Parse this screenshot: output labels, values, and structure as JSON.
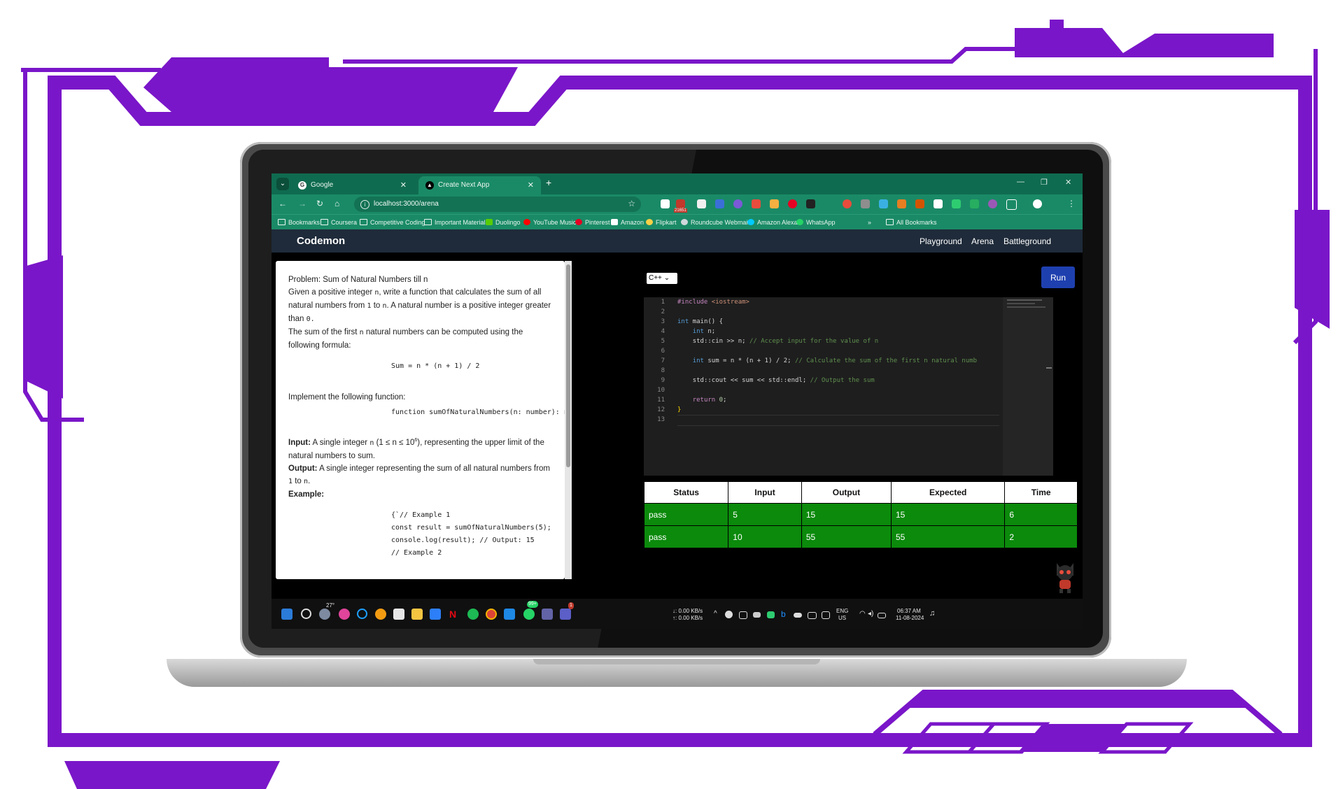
{
  "colors": {
    "purple": "#7a16c9",
    "browser_green": "#1a8a66",
    "tab_green": "#0f6b4f",
    "nav_navy": "#1f2b3a",
    "pass_green": "#0b8a0b",
    "run_blue": "#1e40af"
  },
  "browser": {
    "tabs": [
      {
        "title": "Google",
        "icon": "google-icon"
      },
      {
        "title": "Create Next App",
        "icon": "next-icon"
      }
    ],
    "url": "localhost:3000/arena",
    "bookmarks": [
      "Bookmarks",
      "Coursera",
      "Competitive Coding",
      "Important Materials",
      "Duolingo",
      "YouTube Music",
      "Pinterest",
      "Amazon",
      "Flipkart",
      "Roundcube Webmai...",
      "Amazon Alexa",
      "WhatsApp"
    ],
    "all_bookmarks": "All Bookmarks",
    "more": "»",
    "ext_badge": "21651"
  },
  "app": {
    "brand": "Codemon",
    "nav": [
      "Playground",
      "Arena",
      "Battleground"
    ]
  },
  "problem": {
    "title": "Problem: Sum of Natural Numbers till n",
    "desc1_a": "Given a positive integer ",
    "desc1_b": ", write a function that calculates the sum of all natural numbers from ",
    "desc1_c": " to ",
    "desc1_d": ". A natural number is a positive integer greater than ",
    "desc2_a": "The sum of the first ",
    "desc2_b": " natural numbers can be computed using the following formula:",
    "var_n": "n",
    "one": "1",
    "zero": "0.",
    "formula": "Sum = n * (n + 1) / 2",
    "impl": "Implement the following function:",
    "signature": "function sumOfNaturalNumbers(n: number): number;",
    "input_label": "Input:",
    "input_a": " A single integer ",
    "input_b": " (1 ≤ n ≤ 10",
    "input_sup": "6",
    "input_c": "), representing the upper limit of the natural numbers to sum.",
    "output_label": "Output:",
    "output_text": " A single integer representing the sum of all natural numbers from ",
    "output_end": ".",
    "example_label": "Example:",
    "example_lines": [
      "{`// Example 1",
      "const result = sumOfNaturalNumbers(5);",
      "console.log(result); // Output: 15",
      "",
      "// Example 2"
    ]
  },
  "editor": {
    "language": "C++",
    "run_label": "Run",
    "line_numbers": [
      "1",
      "2",
      "3",
      "4",
      "5",
      "6",
      "7",
      "8",
      "9",
      "10",
      "11",
      "12",
      "13"
    ],
    "code": {
      "l1_pp": "#include",
      "l1_inc": " <iostream>",
      "l3_kw": "int",
      "l3_rest": " main() {",
      "l4_kw": "int",
      "l4_rest": " n;",
      "l5_code": "std::cin >> n; ",
      "l5_cm": "// Accept input for the value of n",
      "l7_kw": "int",
      "l7_code": " sum = n * (n + 1) / 2; ",
      "l7_cm": "// Calculate the sum of the first n natural numb",
      "l9_code": "std::cout << sum << std::endl; ",
      "l9_cm": "// Output the sum",
      "l11_kw": "return",
      "l11_num": " 0",
      "l11_end": ";",
      "l12": "}"
    }
  },
  "results": {
    "headers": [
      "Status",
      "Input",
      "Output",
      "Expected",
      "Time"
    ],
    "rows": [
      {
        "status": "pass",
        "input": "5",
        "output": "15",
        "expected": "15",
        "time": "6"
      },
      {
        "status": "pass",
        "input": "10",
        "output": "55",
        "expected": "55",
        "time": "2"
      }
    ]
  },
  "taskbar": {
    "weather": "27°",
    "net_down": "↓: 0.00 KB/s",
    "net_up": "↑: 0.00 KB/s",
    "lang": "ENG",
    "region": "US",
    "time": "06:37 AM",
    "date": "11-08-2024",
    "badge_whatsapp": "99+",
    "badge_teams": "1"
  }
}
